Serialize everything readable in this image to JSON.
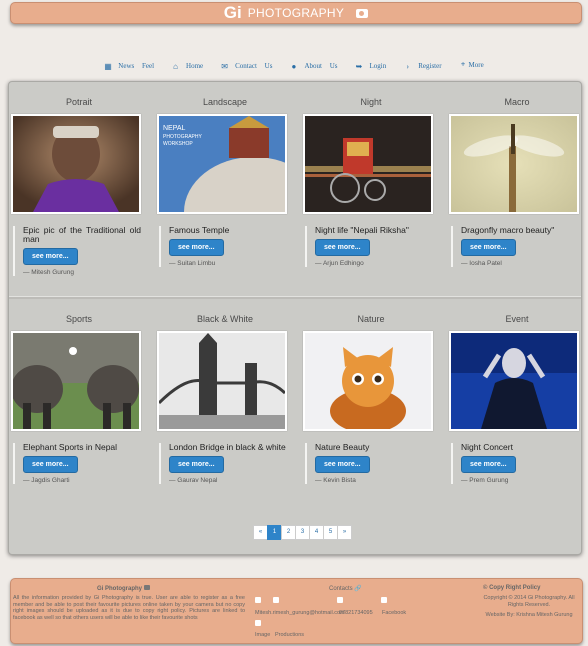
{
  "header": {
    "brand": "Gi",
    "title": "PHOTOGRAPHY"
  },
  "nav": [
    {
      "label": "News Feel",
      "icon": "grid-icon"
    },
    {
      "label": "Home",
      "icon": "home-icon"
    },
    {
      "label": "Contact Us",
      "icon": "envelope-icon"
    },
    {
      "label": "About Us",
      "icon": "info-icon"
    },
    {
      "label": "Login",
      "icon": "login-icon"
    },
    {
      "label": "Register",
      "icon": "chevron-right-icon"
    },
    {
      "label": "More",
      "icon": "plus-icon"
    }
  ],
  "see_more_label": "see more...",
  "cards": [
    {
      "category": "Potrait",
      "caption": "Epic pic of the Traditional old man",
      "author": "— Mitesh Gurung",
      "photo": {
        "image": "portrait-old-man",
        "colors": [
          "#6d4c3a",
          "#6a2fa0",
          "#8a6a55"
        ]
      }
    },
    {
      "category": "Landscape",
      "caption": "Famous Temple",
      "author": "— Suitan Limbu",
      "photo": {
        "image": "temple-workshop-poster",
        "colors": [
          "#4a7fc1",
          "#d8d2c8",
          "#c89a3e"
        ],
        "lines": [
          "NEPAL",
          "PHOTOGRAPHY",
          "WORKSHOP"
        ]
      }
    },
    {
      "category": "Night",
      "caption": "Night life \"Nepali Riksha\"",
      "author": "— Arjun Edhingo",
      "photo": {
        "image": "night-rickshaw",
        "colors": [
          "#2a2320",
          "#c0392b",
          "#e0b050"
        ]
      }
    },
    {
      "category": "Macro",
      "caption": "Dragonfly macro beauty\"",
      "author": "— Iosha Patel",
      "photo": {
        "image": "dragonfly",
        "colors": [
          "#c9c39a",
          "#8a6a3a",
          "#e6e0b8"
        ]
      }
    },
    {
      "category": "Sports",
      "caption": "Elephant Sports in Nepal",
      "author": "— Jagdis Gharti",
      "photo": {
        "image": "elephant-polo",
        "colors": [
          "#4f4a45",
          "#6b8e4e",
          "#2c2a28"
        ]
      }
    },
    {
      "category": "Black & White",
      "caption": "London Bridge in black & white",
      "author": "— Gaurav Nepal",
      "photo": {
        "image": "tower-bridge",
        "colors": [
          "#e8e8e8",
          "#3a3a3a",
          "#9a9a9a"
        ]
      }
    },
    {
      "category": "Nature",
      "caption": "Nature Beauty",
      "author": "— Kevin Bista",
      "photo": {
        "image": "kitten",
        "colors": [
          "#f1f1f3",
          "#e8963a",
          "#c86a20"
        ]
      }
    },
    {
      "category": "Event",
      "caption": "Night Concert",
      "author": "— Prem Gurung",
      "photo": {
        "image": "concert-singer",
        "colors": [
          "#0d2a7a",
          "#1a4cc0",
          "#d6d6e0"
        ]
      }
    }
  ],
  "pagination": [
    "«",
    "1",
    "2",
    "3",
    "4",
    "5",
    "»"
  ],
  "footer": {
    "col1_title": "Gi Photography",
    "col1_text": "All the information provided by Gi Photography is true. User are able to register as a free member and be able to post their favourite pictures online taken by your camera but no copy right images should be uploaded as it is due to copy right policy. Pictures are linked to facebook as well so that others users will be able to like their favourite shots",
    "col2_title": "Contacts",
    "col2_email": "Mitesh.rimesh_gurung@hotmail.com",
    "col2_phone": "07821734095",
    "col2_facebook": "Facebook",
    "col2_image": "Image",
    "col2_productions": "Productions",
    "col3_title": "© Copy Right Policy",
    "col3_text": "Copyright © 2014 Gi Photography. All Rights Reserved.",
    "col3_website": "Website By: Krishna Mitesh Gurung"
  }
}
